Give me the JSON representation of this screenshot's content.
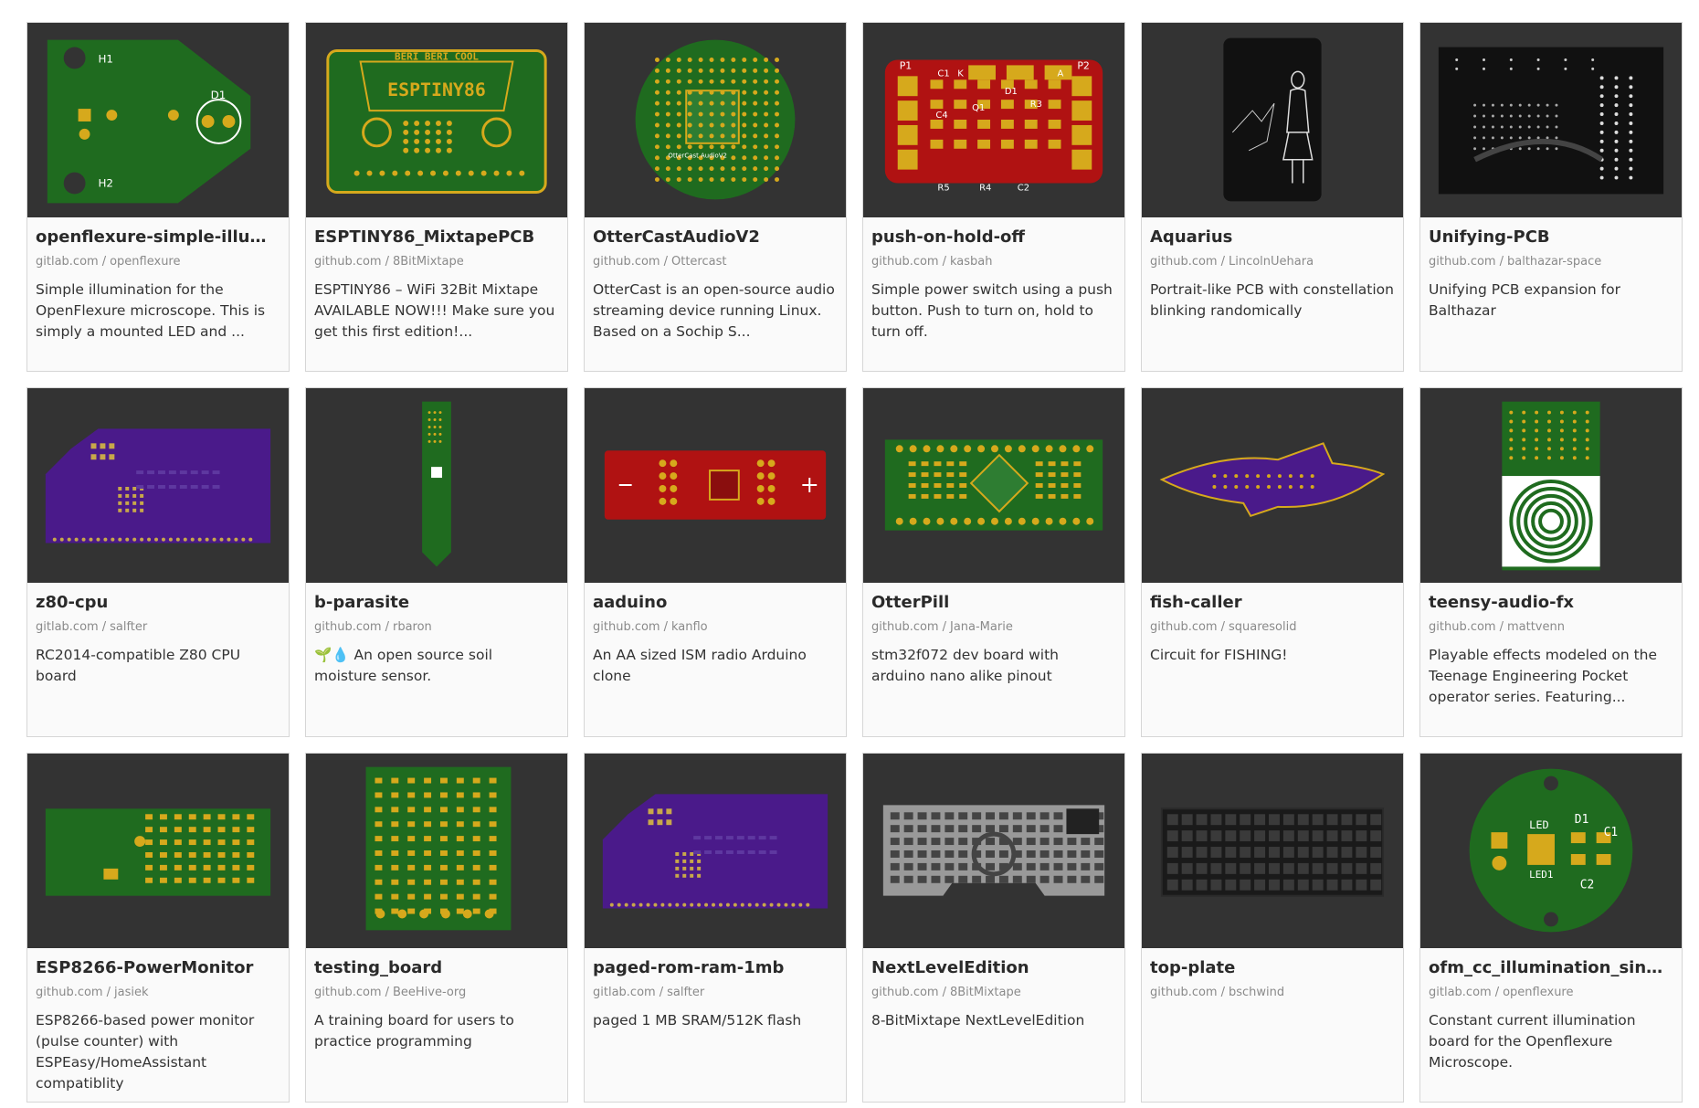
{
  "projects": [
    {
      "title": "openflexure-simple-illumina...",
      "site": "gitlab.com",
      "owner": "openflexure",
      "description": "Simple illumination for the OpenFlexure microscope. This is simply a mounted LED and ...",
      "thumb_icon": "pcb-trapezoid-green-icon",
      "color": "#1f6b1f"
    },
    {
      "title": "ESPTINY86_MixtapePCB",
      "site": "github.com",
      "owner": "8BitMixtape",
      "description": "ESPTINY86 – WiFi 32Bit Mixtape AVAILABLE NOW!!! Make sure you get this first edition!...",
      "thumb_icon": "pcb-cassette-green-icon",
      "color": "#1f6b1f"
    },
    {
      "title": "OtterCastAudioV2",
      "site": "github.com",
      "owner": "Ottercast",
      "description": "OtterCast is an open-source audio streaming device running Linux. Based on a Sochip S...",
      "thumb_icon": "pcb-round-green-icon",
      "color": "#1f6b1f"
    },
    {
      "title": "push-on-hold-off",
      "site": "github.com",
      "owner": "kasbah",
      "description": "Simple power switch using a push button. Push to turn on, hold to turn off.",
      "thumb_icon": "pcb-red-rect-icon",
      "color": "#b01212"
    },
    {
      "title": "Aquarius",
      "site": "github.com",
      "owner": "LincolnUehara",
      "description": "Portrait-like PCB with constellation blinking randomically",
      "thumb_icon": "pcb-black-portrait-icon",
      "color": "#111111"
    },
    {
      "title": "Unifying-PCB",
      "site": "github.com",
      "owner": "balthazar-space",
      "description": "Unifying PCB expansion for Balthazar",
      "thumb_icon": "pcb-black-rect-icon",
      "color": "#111111"
    },
    {
      "title": "z80-cpu",
      "site": "gitlab.com",
      "owner": "salfter",
      "description": "RC2014-compatible Z80 CPU board",
      "thumb_icon": "pcb-purple-card-icon",
      "color": "#4a1a8a"
    },
    {
      "title": "b-parasite",
      "site": "github.com",
      "owner": "rbaron",
      "description": "🌱💧 An open source soil moisture sensor.",
      "thumb_icon": "pcb-probe-green-icon",
      "color": "#1f6b1f"
    },
    {
      "title": "aaduino",
      "site": "github.com",
      "owner": "kanflo",
      "description": "An AA sized ISM radio Arduino clone",
      "thumb_icon": "pcb-red-aa-icon",
      "color": "#b01212"
    },
    {
      "title": "OtterPill",
      "site": "github.com",
      "owner": "Jana-Marie",
      "description": "stm32f072 dev board with arduino nano alike pinout",
      "thumb_icon": "pcb-green-pill-icon",
      "color": "#1f6b1f"
    },
    {
      "title": "fish-caller",
      "site": "github.com",
      "owner": "squaresolid",
      "description": "Circuit for FISHING!",
      "thumb_icon": "pcb-purple-fish-icon",
      "color": "#4a1a8a"
    },
    {
      "title": "teensy-audio-fx",
      "site": "github.com",
      "owner": "mattvenn",
      "description": "Playable effects modeled on the Teenage Engineering Pocket operator series. Featuring...",
      "thumb_icon": "pcb-green-spiral-icon",
      "color": "#1f6b1f"
    },
    {
      "title": "ESP8266-PowerMonitor",
      "site": "github.com",
      "owner": "jasiek",
      "description": "ESP8266-based power monitor (pulse counter) with ESPEasy/HomeAssistant compatiblity",
      "thumb_icon": "pcb-green-wide-icon",
      "color": "#1f6b1f"
    },
    {
      "title": "testing_board",
      "site": "github.com",
      "owner": "BeeHive-org",
      "description": "A training board for users to practice programming",
      "thumb_icon": "pcb-green-square-icon",
      "color": "#1f6b1f"
    },
    {
      "title": "paged-rom-ram-1mb",
      "site": "gitlab.com",
      "owner": "salfter",
      "description": "paged 1 MB SRAM/512K flash",
      "thumb_icon": "pcb-purple-card-icon",
      "color": "#4a1a8a"
    },
    {
      "title": "NextLevelEdition",
      "site": "github.com",
      "owner": "8BitMixtape",
      "description": "8-BitMixtape NextLevelEdition",
      "thumb_icon": "pcb-gray-cassette-icon",
      "color": "#bbbbbb"
    },
    {
      "title": "top-plate",
      "site": "github.com",
      "owner": "bschwind",
      "description": "",
      "thumb_icon": "keyboard-plate-icon",
      "color": "#1a1a1a"
    },
    {
      "title": "ofm_cc_illumination_single",
      "site": "gitlab.com",
      "owner": "openflexure",
      "description": "Constant current illumination board for the Openflexure Microscope.",
      "thumb_icon": "pcb-round-led-icon",
      "color": "#1f6b1f"
    }
  ],
  "thumb_labels": {
    "esptiny_top": "BERI BERI COOL",
    "esptiny_name": "ESPTINY86",
    "ottercast_label": "OtterCast AudioV2",
    "push_p1": "P1",
    "push_p2": "P2",
    "push_c1": "C1",
    "push_k": "K",
    "push_a": "A",
    "push_d1": "D1",
    "push_q1": "Q1",
    "push_r3": "R3",
    "push_c4": "C4",
    "push_r1": "R1",
    "push_r2": "R2",
    "push_r6": "R6",
    "push_r5": "R5",
    "push_r4": "R4",
    "push_c2": "C2",
    "flex_h1": "H1",
    "flex_h2": "H2",
    "flex_d1": "D1",
    "z80_title": "Z80 CPU Card with Clock",
    "ofm_led": "LED",
    "ofm_d1": "D1",
    "ofm_c1": "C1",
    "ofm_led1": "LED1",
    "ofm_c2": "C2"
  }
}
